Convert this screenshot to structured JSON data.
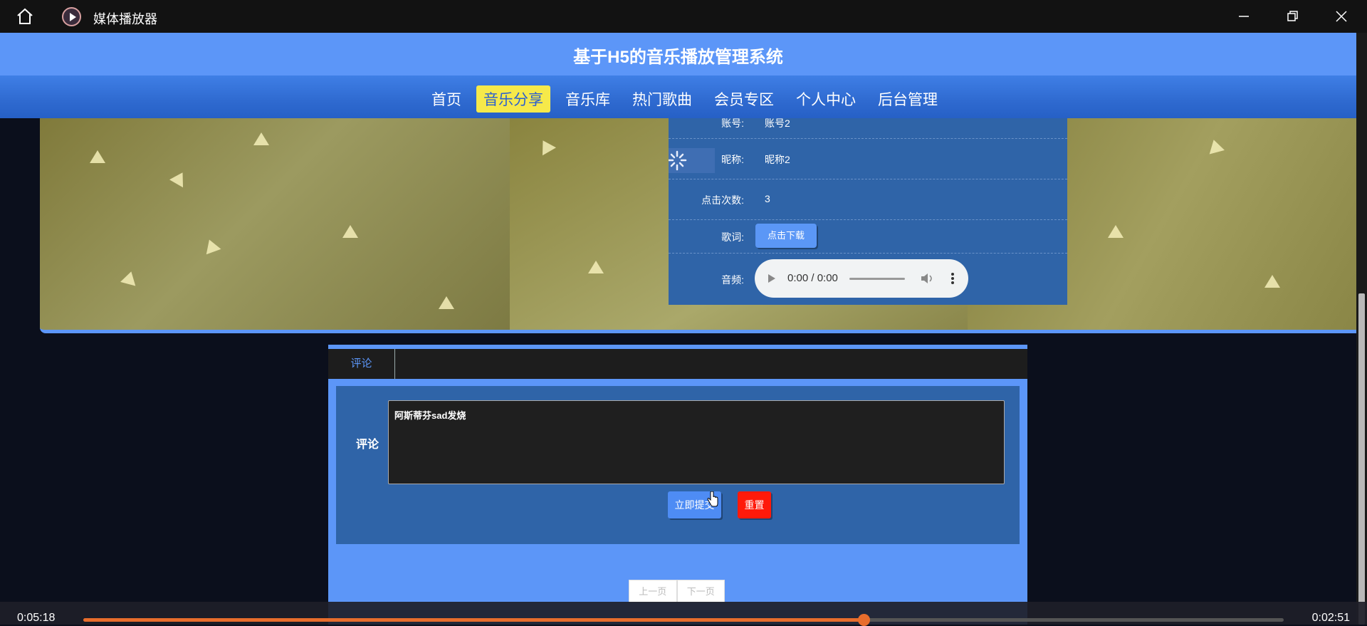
{
  "window": {
    "app_title": "媒体播放器"
  },
  "site": {
    "title": "基于H5的音乐播放管理系统",
    "nav": [
      "首页",
      "音乐分享",
      "音乐库",
      "热门歌曲",
      "会员专区",
      "个人中心",
      "后台管理"
    ],
    "active_nav": "音乐分享"
  },
  "info": {
    "account_label": "账号:",
    "account_value": "账号2",
    "nickname_label": "昵称:",
    "nickname_value": "昵称2",
    "clicks_label": "点击次数:",
    "clicks_value": "3",
    "lyrics_label": "歌词:",
    "download_btn": "点击下载",
    "audio_label": "音频:",
    "audio_time": "0:00 / 0:00"
  },
  "comments": {
    "tab": "评论",
    "form_label": "评论",
    "text": "阿斯蒂芬sad发烧",
    "submit_btn": "立即提交",
    "reset_btn": "重置",
    "prev_page": "上一页",
    "next_page": "下一页"
  },
  "player": {
    "elapsed": "0:05:18",
    "remaining": "0:02:51",
    "progress": 0.65
  },
  "colors": {
    "accent": "#5c96f8",
    "nav_active": "#f6e94a",
    "reset": "#ff1a0a",
    "progress": "#e86d2c"
  }
}
